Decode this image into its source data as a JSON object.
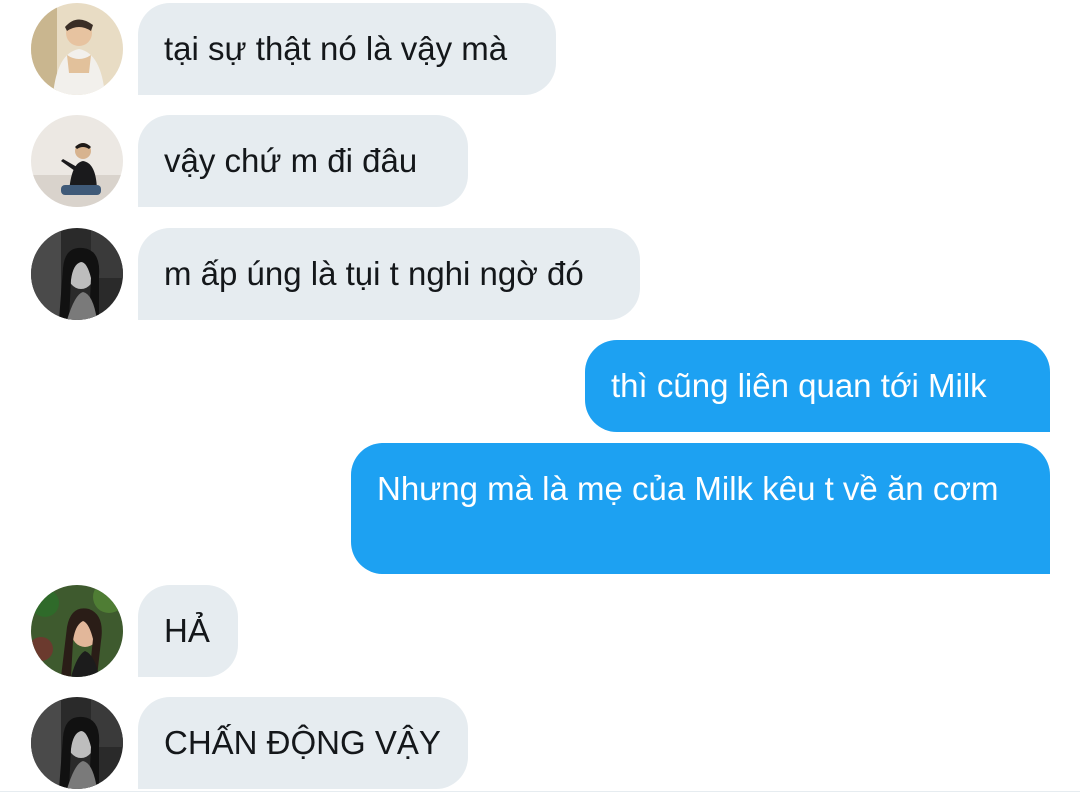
{
  "conversation": {
    "messages": [
      {
        "sender": "other",
        "avatar": "avatar-man-white-tank",
        "text": "tại sự thật nó là vậy mà"
      },
      {
        "sender": "other",
        "avatar": "avatar-man-sitting",
        "text": "vậy chứ m đi đâu"
      },
      {
        "sender": "other",
        "avatar": "avatar-woman-bw",
        "text": "m ấp úng là tụi t nghi ngờ đó"
      },
      {
        "sender": "me",
        "text": "thì cũng liên quan tới Milk"
      },
      {
        "sender": "me",
        "text": "Nhưng mà là mẹ của Milk kêu t về ăn cơm"
      },
      {
        "sender": "other",
        "avatar": "avatar-woman-plants",
        "text": "HẢ"
      },
      {
        "sender": "other",
        "avatar": "avatar-woman-bw",
        "text": "CHẤN ĐỘNG VẬY"
      }
    ]
  },
  "colors": {
    "incoming_bubble": "#e6ecf0",
    "outgoing_bubble": "#1da1f2",
    "incoming_text": "#14171a",
    "outgoing_text": "#ffffff"
  }
}
